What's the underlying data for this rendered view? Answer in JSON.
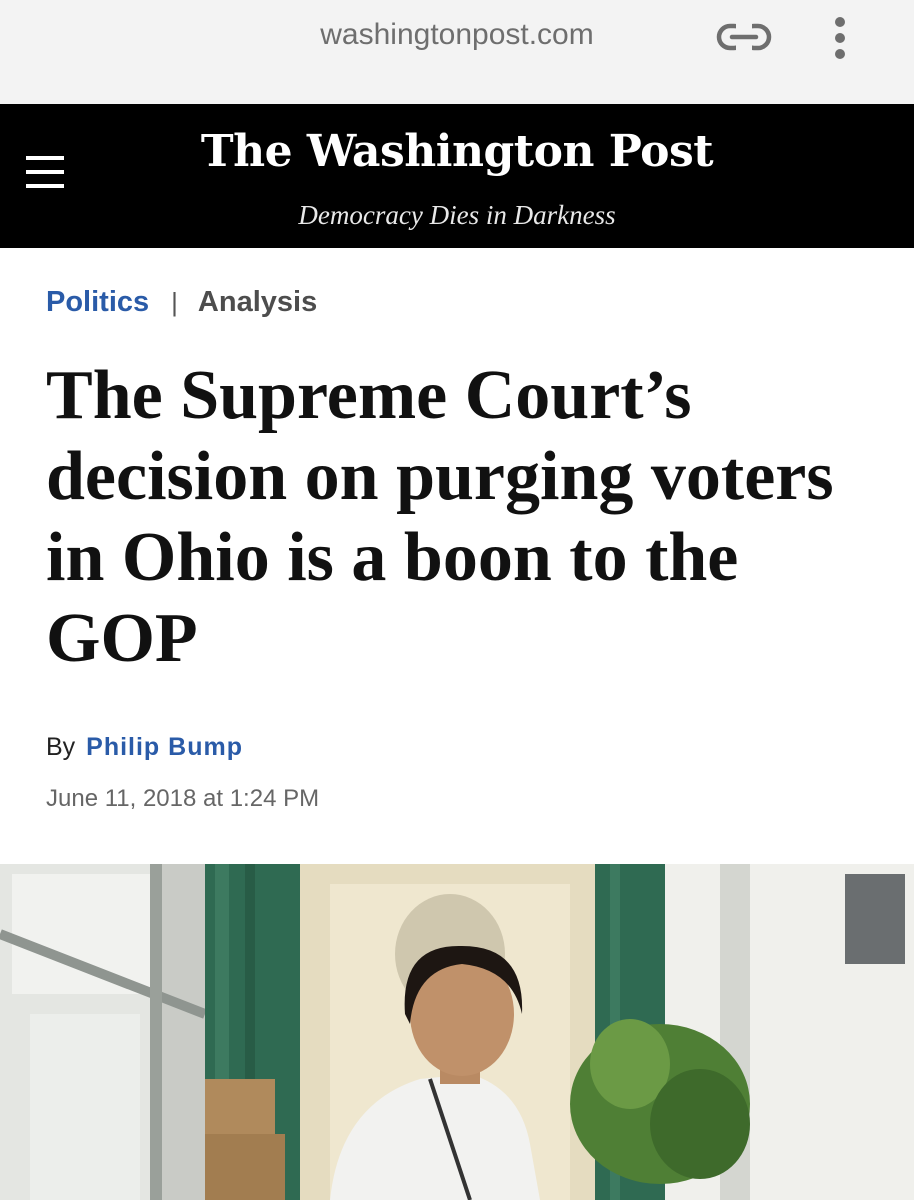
{
  "browser": {
    "url": "washingtonpost.com",
    "icons": [
      "link-icon",
      "more-vertical-icon"
    ]
  },
  "masthead": {
    "logo": "The Washington Post",
    "tagline": "Democracy Dies in Darkness",
    "icons": [
      "hamburger-menu-icon"
    ]
  },
  "article": {
    "section": "Politics",
    "separator": "|",
    "label": "Analysis",
    "headline": "The Supreme Court’s decision on purging voters in Ohio is a boon to the GOP",
    "byline_prefix": "By",
    "author": "Philip Bump",
    "date": "June 11, 2018 at 1:24 PM"
  },
  "colors": {
    "masthead_bg": "#000000",
    "section_link": "#2a5ba8",
    "url_bar_bg": "#f3f3f3"
  }
}
